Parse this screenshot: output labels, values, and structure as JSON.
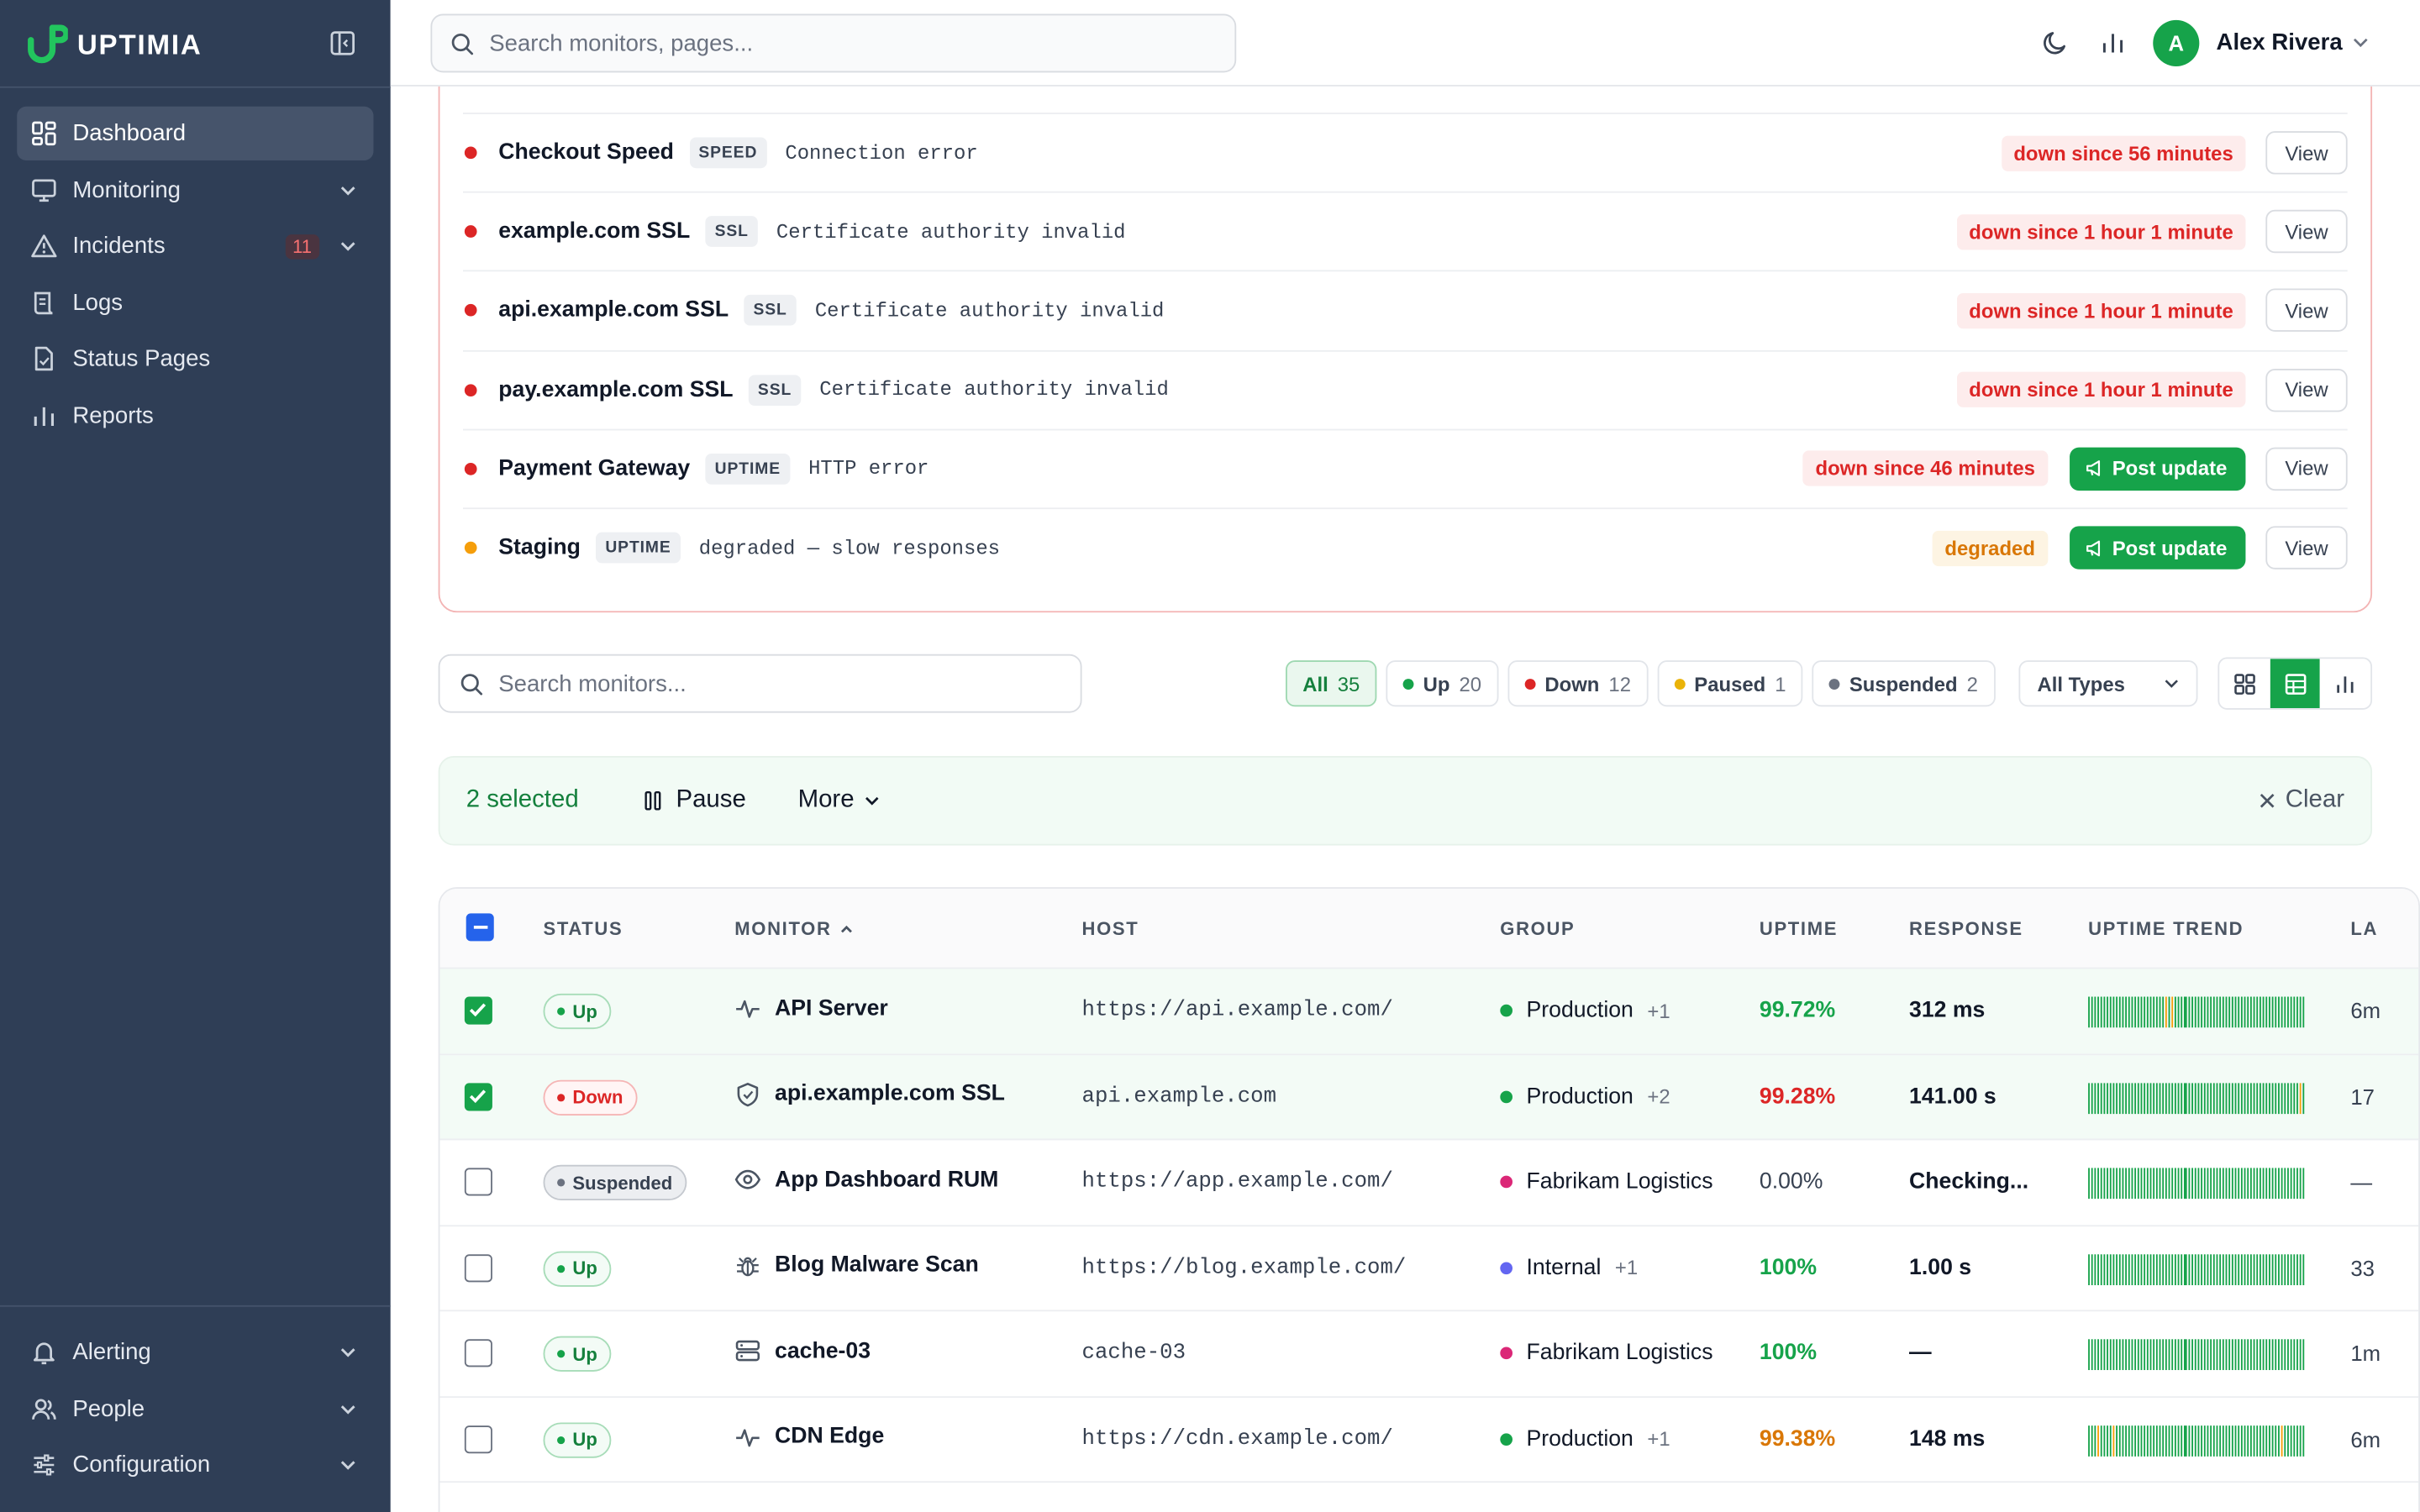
{
  "brand": {
    "name": "UPTIMIA"
  },
  "sidebar": {
    "items": [
      {
        "label": "Dashboard",
        "icon": "dashboard-icon",
        "active": true
      },
      {
        "label": "Monitoring",
        "icon": "monitor-icon",
        "expandable": true
      },
      {
        "label": "Incidents",
        "icon": "warning-icon",
        "badge": "11",
        "expandable": true
      },
      {
        "label": "Logs",
        "icon": "logs-icon"
      },
      {
        "label": "Status Pages",
        "icon": "document-icon"
      },
      {
        "label": "Reports",
        "icon": "bar-chart-icon"
      }
    ],
    "bottom_items": [
      {
        "label": "Alerting",
        "icon": "bell-icon"
      },
      {
        "label": "People",
        "icon": "people-icon"
      },
      {
        "label": "Configuration",
        "icon": "sliders-icon"
      }
    ]
  },
  "topbar": {
    "search_placeholder": "Search monitors, pages...",
    "user_initial": "A",
    "user_name": "Alex Rivera"
  },
  "incidents": [
    {
      "name": "Checkout Speed",
      "type": "SPEED",
      "message": "Connection error",
      "status": "down since 56 minutes",
      "severity": "down",
      "post_update": false,
      "view": "View"
    },
    {
      "name": "example.com SSL",
      "type": "SSL",
      "message": "Certificate authority invalid",
      "status": "down since 1 hour 1 minute",
      "severity": "down",
      "post_update": false,
      "view": "View"
    },
    {
      "name": "api.example.com SSL",
      "type": "SSL",
      "message": "Certificate authority invalid",
      "status": "down since 1 hour 1 minute",
      "severity": "down",
      "post_update": false,
      "view": "View"
    },
    {
      "name": "pay.example.com SSL",
      "type": "SSL",
      "message": "Certificate authority invalid",
      "status": "down since 1 hour 1 minute",
      "severity": "down",
      "post_update": false,
      "view": "View"
    },
    {
      "name": "Payment Gateway",
      "type": "UPTIME",
      "message": "HTTP error",
      "status": "down since 46 minutes",
      "severity": "down",
      "post_update": true,
      "view": "View"
    },
    {
      "name": "Staging",
      "type": "UPTIME",
      "message": "degraded — slow responses",
      "status": "degraded",
      "severity": "degraded",
      "post_update": true,
      "view": "View"
    }
  ],
  "post_update_label": "Post update",
  "filters": {
    "search_placeholder": "Search monitors...",
    "chips": [
      {
        "label": "All",
        "count": "35",
        "active": true
      },
      {
        "label": "Up",
        "count": "20",
        "dot": "#16a34a"
      },
      {
        "label": "Down",
        "count": "12",
        "dot": "#dc2626"
      },
      {
        "label": "Paused",
        "count": "1",
        "dot": "#eab308"
      },
      {
        "label": "Suspended",
        "count": "2",
        "dot": "#6b7280"
      }
    ],
    "type_select": "All Types"
  },
  "selection": {
    "count_label": "2 selected",
    "pause_label": "Pause",
    "more_label": "More",
    "clear_label": "Clear"
  },
  "table": {
    "headers": {
      "status": "STATUS",
      "monitor": "MONITOR",
      "host": "HOST",
      "group": "GROUP",
      "uptime": "UPTIME",
      "response": "RESPONSE",
      "trend": "UPTIME TREND",
      "last": "LA"
    },
    "rows": [
      {
        "checked": true,
        "status": "Up",
        "icon": "pulse-icon",
        "monitor": "API Server",
        "host": "https://api.example.com/",
        "group": "Production",
        "group_color": "#16a34a",
        "group_extra": "+1",
        "uptime": "99.72%",
        "uptime_color": "#16a34a",
        "response": "312 ms",
        "last": "6m"
      },
      {
        "checked": true,
        "status": "Down",
        "icon": "shield-icon",
        "monitor": "api.example.com SSL",
        "host": "api.example.com",
        "group": "Production",
        "group_color": "#16a34a",
        "group_extra": "+2",
        "uptime": "99.28%",
        "uptime_color": "#dc2626",
        "response": "141.00 s",
        "last": "17"
      },
      {
        "checked": false,
        "status": "Suspended",
        "icon": "eye-icon",
        "monitor": "App Dashboard RUM",
        "host": "https://app.example.com/",
        "group": "Fabrikam Logistics",
        "group_color": "#db2777",
        "group_extra": "",
        "uptime": "0.00%",
        "uptime_color": "#374151",
        "response": "Checking...",
        "last": "—"
      },
      {
        "checked": false,
        "status": "Up",
        "icon": "bug-icon",
        "monitor": "Blog Malware Scan",
        "host": "https://blog.example.com/",
        "group": "Internal",
        "group_color": "#6366f1",
        "group_extra": "+1",
        "uptime": "100%",
        "uptime_color": "#16a34a",
        "response": "1.00 s",
        "last": "33"
      },
      {
        "checked": false,
        "status": "Up",
        "icon": "server-icon",
        "monitor": "cache-03",
        "host": "cache-03",
        "group": "Fabrikam Logistics",
        "group_color": "#db2777",
        "group_extra": "",
        "uptime": "100%",
        "uptime_color": "#16a34a",
        "response": "—",
        "last": "1m"
      },
      {
        "checked": false,
        "status": "Up",
        "icon": "pulse-icon",
        "monitor": "CDN Edge",
        "host": "https://cdn.example.com/",
        "group": "Production",
        "group_color": "#16a34a",
        "group_extra": "+1",
        "uptime": "99.38%",
        "uptime_color": "#d97706",
        "response": "148 ms",
        "last": "6m"
      }
    ]
  },
  "colors": {
    "sidebar_bg": "#2f3e56",
    "accent_green": "#16a34a",
    "danger": "#dc2626",
    "warning": "#d97706"
  }
}
